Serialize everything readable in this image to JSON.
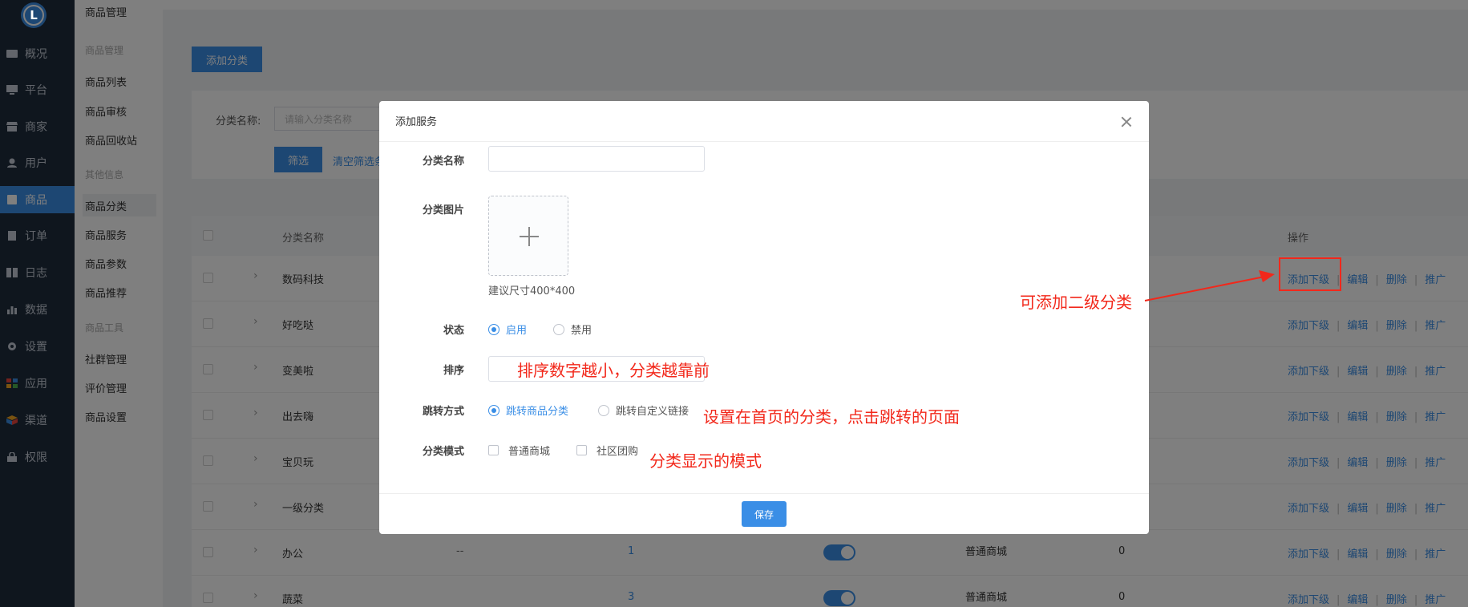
{
  "nav": {
    "logo": "L",
    "items": [
      {
        "label": "概况",
        "icon": "dashboard-icon"
      },
      {
        "label": "平台",
        "icon": "monitor-icon"
      },
      {
        "label": "商家",
        "icon": "store-icon"
      },
      {
        "label": "用户",
        "icon": "user-icon"
      },
      {
        "label": "商品",
        "icon": "goods-icon",
        "active": true
      },
      {
        "label": "订单",
        "icon": "order-icon"
      },
      {
        "label": "日志",
        "icon": "log-icon"
      },
      {
        "label": "数据",
        "icon": "chart-icon"
      },
      {
        "label": "设置",
        "icon": "gear-icon"
      },
      {
        "label": "应用",
        "icon": "apps-icon"
      },
      {
        "label": "渠道",
        "icon": "channel-icon"
      },
      {
        "label": "权限",
        "icon": "lock-icon"
      }
    ]
  },
  "submenu": {
    "title": "商品管理",
    "groups": [
      {
        "heading": "商品管理",
        "items": [
          "商品列表",
          "商品审核",
          "商品回收站"
        ]
      },
      {
        "heading": "其他信息",
        "items": [
          "商品分类",
          "商品服务",
          "商品参数",
          "商品推荐"
        ]
      },
      {
        "heading": "商品工具",
        "items": [
          "社群管理",
          "评价管理",
          "商品设置"
        ]
      }
    ],
    "active": "商品分类"
  },
  "page": {
    "add_category_button": "添加分类",
    "filter": {
      "label": "分类名称:",
      "placeholder": "请输入分类名称",
      "filter_button": "筛选",
      "clear_link": "清空筛选条件"
    },
    "table": {
      "columns": {
        "name": "分类名称",
        "ops": "操作"
      },
      "rows": [
        {
          "name": "数码科技"
        },
        {
          "name": "好吃哒"
        },
        {
          "name": "变美啦"
        },
        {
          "name": "出去嗨"
        },
        {
          "name": "宝贝玩"
        },
        {
          "name": "一级分类"
        },
        {
          "name": "办公",
          "image": "--",
          "sort": "1",
          "mode": "普通商城",
          "count": "0"
        },
        {
          "name": "蔬菜",
          "sort": "3",
          "mode": "普通商城",
          "count": "0"
        }
      ],
      "ops": [
        "添加下级",
        "编辑",
        "删除",
        "推广"
      ]
    }
  },
  "modal": {
    "title": "添加服务",
    "fields": {
      "name_label": "分类名称",
      "name_value": "",
      "image_label": "分类图片",
      "image_hint": "建议尺寸400*400",
      "status_label": "状态",
      "status_options": [
        "启用",
        "禁用"
      ],
      "status_selected": "启用",
      "sort_label": "排序",
      "sort_value": "",
      "jump_label": "跳转方式",
      "jump_options": [
        "跳转商品分类",
        "跳转自定义链接"
      ],
      "jump_selected": "跳转商品分类",
      "mode_label": "分类模式",
      "mode_options": [
        "普通商城",
        "社区团购"
      ]
    },
    "save_button": "保存"
  },
  "annotations": {
    "sub_category": "可添加二级分类",
    "sort_tip": "排序数字越小，分类越靠前",
    "jump_tip": "设置在首页的分类，点击跳转的页面",
    "mode_tip": "分类显示的模式"
  },
  "colors": {
    "accent": "#3a8ee6",
    "nav_bg": "#1f2d3d",
    "annotation": "#f2281b"
  }
}
